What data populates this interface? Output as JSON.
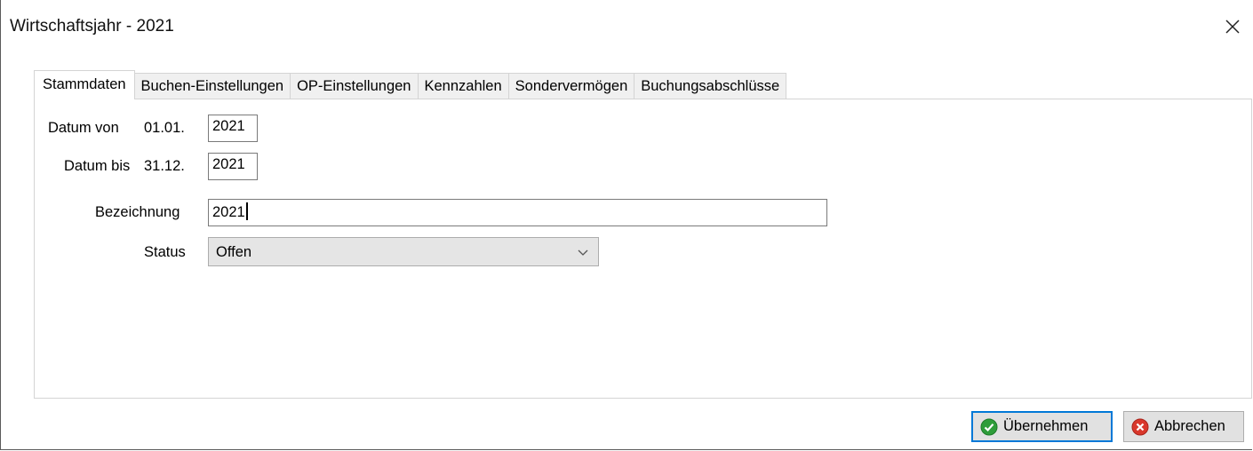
{
  "window": {
    "title": "Wirtschaftsjahr - 2021"
  },
  "tabs": [
    {
      "label": "Stammdaten",
      "active": true
    },
    {
      "label": "Buchen-Einstellungen",
      "active": false
    },
    {
      "label": "OP-Einstellungen",
      "active": false
    },
    {
      "label": "Kennzahlen",
      "active": false
    },
    {
      "label": "Sondervermögen",
      "active": false
    },
    {
      "label": "Buchungsabschlüsse",
      "active": false
    }
  ],
  "form": {
    "datum_von": {
      "label": "Datum von",
      "prefix": "01.01.",
      "value": "2021"
    },
    "datum_bis": {
      "label": "Datum bis",
      "prefix": "31.12.",
      "value": "2021"
    },
    "bezeichnung": {
      "label": "Bezeichnung",
      "value": "2021"
    },
    "status": {
      "label": "Status",
      "value": "Offen"
    }
  },
  "buttons": {
    "apply": {
      "label": "Übernehmen",
      "icon": "check-circle-icon",
      "color": "#2e9d3a"
    },
    "cancel": {
      "label": "Abbrechen",
      "icon": "cancel-circle-icon",
      "color": "#d9372b"
    }
  },
  "colors": {
    "focus_border": "#0078d7",
    "select_bg": "#e5e5e5"
  }
}
